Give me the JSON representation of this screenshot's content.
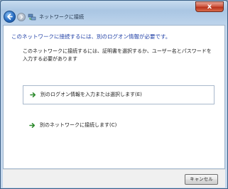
{
  "window": {
    "title": "ネットワークに接続",
    "close_glyph": "x"
  },
  "main": {
    "heading": "このネットワークに接続するには、別のログオン情報が必要です。",
    "description": "このネットワークに接続するには、証明書を選択するか、ユーザー名とパスワードを入力する必要があります",
    "options": [
      {
        "label": "別のログオン情報を入力または選択します(E)"
      },
      {
        "label": "別のネットワークに接続します(C)"
      }
    ]
  },
  "footer": {
    "cancel_label": "キャンセル"
  },
  "colors": {
    "heading": "#1f3fa6",
    "arrow": "#2e8b2e"
  }
}
